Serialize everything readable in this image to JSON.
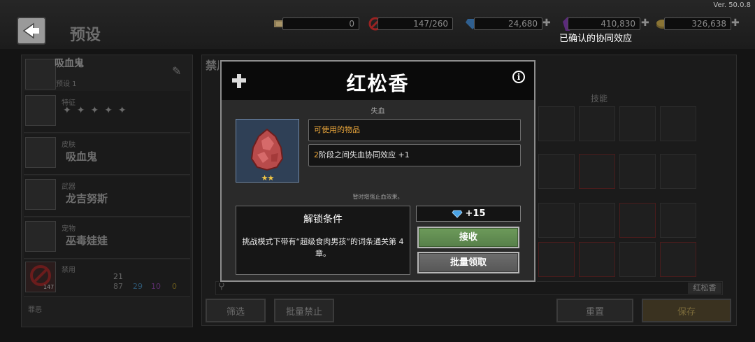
{
  "app": {
    "version": "Ver. 50.0.8",
    "page_title": "预设",
    "toast": "已确认的协同效应"
  },
  "resources": [
    {
      "name": "ticket",
      "value": "0"
    },
    {
      "name": "ban",
      "value": "147/260"
    },
    {
      "name": "diamond",
      "value": "24,680"
    },
    {
      "name": "crystal",
      "value": "410,830"
    },
    {
      "name": "gold",
      "value": "326,638"
    }
  ],
  "left_panel": {
    "preset_name": "吸血鬼",
    "preset_sub": "预设 1",
    "rows": [
      {
        "label": "特征",
        "value": ""
      },
      {
        "label": "皮肤",
        "value": "吸血鬼"
      },
      {
        "label": "武器",
        "value": "龙吉努斯"
      },
      {
        "label": "宠物",
        "value": "巫毒娃娃"
      },
      {
        "label": "禁用",
        "value": ""
      }
    ],
    "ban_badge": "147",
    "ban_stats": {
      "total": "21",
      "s1": "87",
      "s2": "29",
      "s3": "10",
      "s4": "0"
    },
    "footer_label": "罪恶"
  },
  "right_panel": {
    "title": "禁用",
    "tab_skill": "技能",
    "search_tag": "红松香",
    "filter_btn": "筛选",
    "batch_ban_btn": "批量禁止",
    "reset_btn": "重置",
    "save_btn": "保存"
  },
  "modal": {
    "title": "红松香",
    "category": "失血",
    "item_type": "可使用的物品",
    "effect_num": "2",
    "effect_text": "阶段之间失血协同效应 +1",
    "hint": "暂时增强止血效果。",
    "unlock_title": "解锁条件",
    "unlock_desc": "挑战模式下带有“超级食肉男孩”的词条通关第 4 章。",
    "reward": "+15",
    "stars": "★★",
    "accept_btn": "接收",
    "batch_btn": "批量领取"
  }
}
